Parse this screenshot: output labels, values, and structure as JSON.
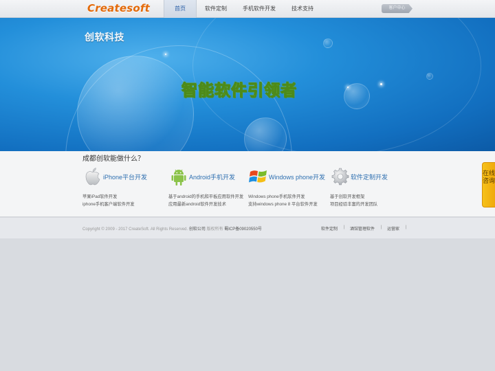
{
  "header": {
    "logo": "Createsoft",
    "nav": [
      "首页",
      "软件定制",
      "手机软件开发",
      "技术支持"
    ],
    "client_button": "客户中心"
  },
  "banner": {
    "brand": "创软科技",
    "slogan": "智能软件引领者"
  },
  "services": {
    "title": "成都创软能做什么？",
    "items": [
      {
        "name": "iPhone平台开发",
        "icon": "apple-icon",
        "desc1": "苹果iPad软件开发",
        "desc2": "iphone手机客户端软件开发"
      },
      {
        "name": "Android手机开发",
        "icon": "android-icon",
        "desc1": "基于android的手机和平板应用软件开发",
        "desc2": "应用最新android软件开发技术"
      },
      {
        "name": "Windows phone开发",
        "icon": "windows-icon",
        "desc1": "Windows phone手机软件开发",
        "desc2": "支持windows phone 8 平台软件开发"
      },
      {
        "name": "软件定制开发",
        "icon": "gear-icon",
        "desc1": "基于创软开发框架",
        "desc2": "项目经验丰富的开发团队"
      }
    ]
  },
  "consult": "在线咨询",
  "footer": {
    "copyright": "Copyright © 2009 - 2017  CreateSoft. All Rights Reserved.",
    "company": "创软公司",
    "rights": "版权所有",
    "icp": "蜀ICP备09020550号",
    "links": [
      "软件定制",
      "酒馆管理软件",
      "运营家"
    ],
    "separator": "|"
  },
  "colors": {
    "accent": "#2d6fb0",
    "logo": "#e36a0a",
    "consult": "#f4b514"
  }
}
